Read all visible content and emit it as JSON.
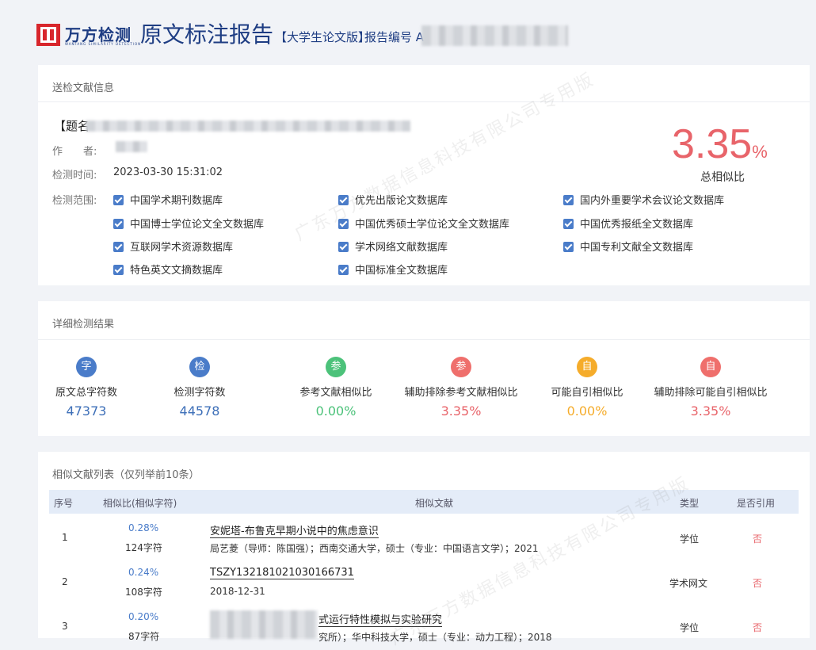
{
  "header": {
    "logo_text": "万方检测",
    "logo_sub": "WANFANG SIMILARITY DETECTION",
    "title": "原文标注报告",
    "subtitle": "【大学生论文版】",
    "report_no_label": "报告编号 A"
  },
  "watermark": "广东万方数据信息科技有限公司专用版",
  "info_card": {
    "section_title": "送检文献信息",
    "title_label": "【题名",
    "author_label": "作　　者:",
    "time_label": "检测时间:",
    "time_value": "2023-03-30 15:31:02",
    "scope_label": "检测范围:",
    "databases": [
      "中国学术期刊数据库",
      "优先出版论文数据库",
      "国内外重要学术会议论文数据库",
      "中国博士学位论文全文数据库",
      "中国优秀硕士学位论文全文数据库",
      "中国优秀报纸全文数据库",
      "互联网学术资源数据库",
      "学术网络文献数据库",
      "中国专利文献全文数据库",
      "特色英文文摘数据库",
      "中国标准全文数据库"
    ],
    "total_similarity": "3.35",
    "total_similarity_unit": "%",
    "total_similarity_label": "总相似比"
  },
  "results_card": {
    "section_title": "详细检测结果",
    "stats": [
      {
        "icon_char": "字",
        "icon_name": "char-count-icon",
        "color": "#4a7cc9",
        "label": "原文总字符数",
        "value": "47373",
        "value_color": "#3d6fb8"
      },
      {
        "icon_char": "检",
        "icon_name": "check-count-icon",
        "color": "#4a7cc9",
        "label": "检测字符数",
        "value": "44578",
        "value_color": "#3d6fb8"
      },
      {
        "icon_char": "参",
        "icon_name": "reference-icon",
        "color": "#4cc27a",
        "label": "参考文献相似比",
        "value": "0.00%",
        "value_color": "#4cc27a"
      },
      {
        "icon_char": "参",
        "icon_name": "exclude-reference-icon",
        "color": "#ef6f6c",
        "label": "辅助排除参考文献相似比",
        "value": "3.35%",
        "value_color": "#e8646a"
      },
      {
        "icon_char": "自",
        "icon_name": "self-cite-icon",
        "color": "#f5ac2b",
        "label": "可能自引相似比",
        "value": "0.00%",
        "value_color": "#f5ac2b"
      },
      {
        "icon_char": "自",
        "icon_name": "exclude-self-cite-icon",
        "color": "#ef6f6c",
        "label": "辅助排除可能自引相似比",
        "value": "3.35%",
        "value_color": "#e8646a"
      }
    ]
  },
  "similar_card": {
    "section_title": "相似文献列表（仅列举前10条）",
    "columns": [
      "序号",
      "相似比(相似字符)",
      "相似文献",
      "类型",
      "是否引用"
    ],
    "rows": [
      {
        "index": "1",
        "percent": "0.28%",
        "chars": "124字符",
        "doc_title": "安妮塔-布鲁克早期小说中的焦虑意识",
        "doc_detail": "局艺菱（导师：陈国强）；西南交通大学，硕士（专业：中国语言文学）；2021",
        "type": "学位",
        "cited": "否"
      },
      {
        "index": "2",
        "percent": "0.24%",
        "chars": "108字符",
        "doc_title": "TSZY1321810210301667​31",
        "doc_detail": "2018-12-31",
        "type": "学术网文",
        "cited": "否"
      },
      {
        "index": "3",
        "percent": "0.20%",
        "chars": "87字符",
        "doc_title": "式运行特性模拟与实验研究",
        "doc_detail": "究所）；华中科技大学，硕士（专业：动力工程）；2018",
        "type": "学位",
        "cited": "否"
      }
    ]
  }
}
